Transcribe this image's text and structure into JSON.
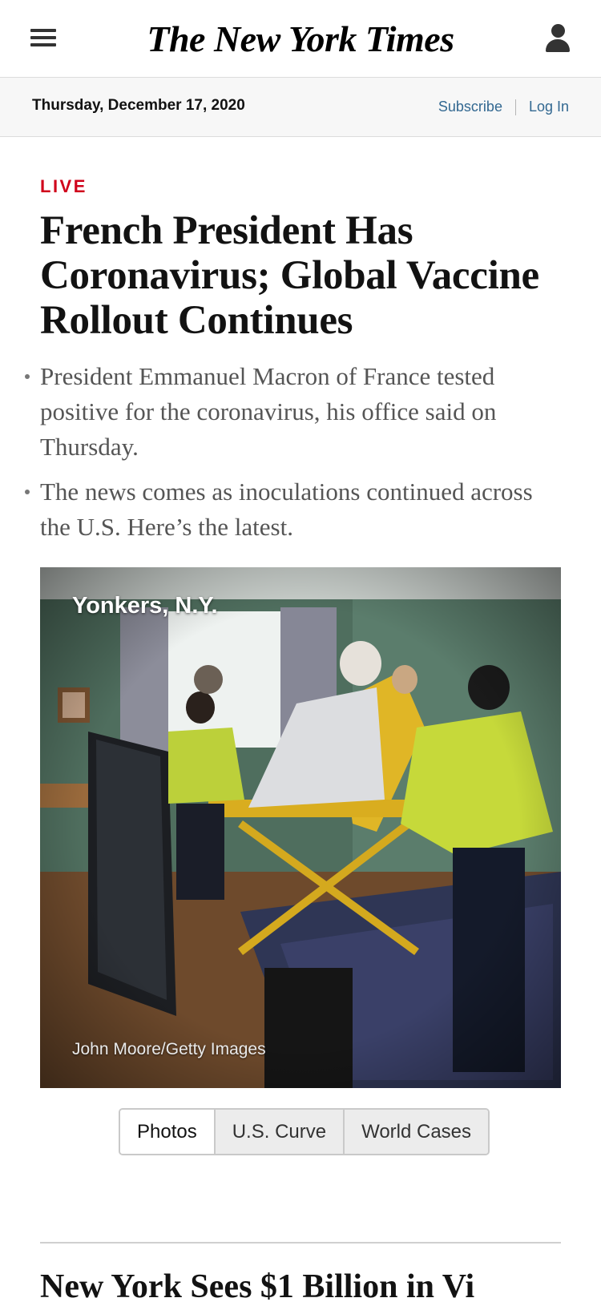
{
  "masthead": {
    "logo_text": "The New York Times",
    "menu_icon": "hamburger-menu-icon",
    "account_icon": "user-account-icon"
  },
  "datebar": {
    "date": "Thursday, December 17, 2020",
    "subscribe_label": "Subscribe",
    "login_label": "Log In",
    "link_color": "#326891"
  },
  "article": {
    "live_label": "LIVE",
    "live_color": "#d0021b",
    "headline": "French President Has Coronavirus; Global Vaccine Rollout Continues",
    "summary": [
      "President Emmanuel Macron of France tested positive for the coronavirus, his office said on Thursday.",
      "The news comes as inoculations continued across the U.S. Here’s the latest."
    ],
    "photo": {
      "location": "Yonkers, N.Y.",
      "credit": "John Moore/Getty Images"
    },
    "tabs": [
      "Photos",
      "U.S. Curve",
      "World Cases"
    ],
    "selected_tab": "Photos"
  },
  "next_story": {
    "headline": "New York Sees $1 Billion in Vi"
  }
}
